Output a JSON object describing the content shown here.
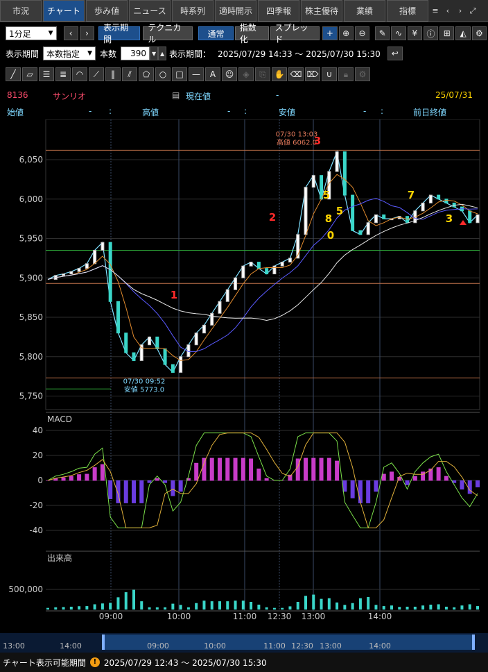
{
  "tabs": [
    {
      "label": "市況",
      "active": false
    },
    {
      "label": "チャート",
      "active": true
    },
    {
      "label": "歩み値",
      "active": false
    },
    {
      "label": "ニュース",
      "active": false
    },
    {
      "label": "時系列",
      "active": false
    },
    {
      "label": "適時開示",
      "active": false
    },
    {
      "label": "四季報",
      "active": false
    },
    {
      "label": "株主優待",
      "active": false
    },
    {
      "label": "業績",
      "active": false
    },
    {
      "label": "指標",
      "active": false
    }
  ],
  "toolbar": {
    "interval": "1分足",
    "display_period": "表示期間",
    "technical": "テクニカル",
    "normal": "通常",
    "index": "指数化",
    "spread": "スプレッド"
  },
  "period": {
    "label": "表示期間",
    "mode": "本数指定",
    "count_label": "本数",
    "count": "390",
    "range_label": "表示期間：",
    "range": "2025/07/29 14:33 ～ 2025/07/30 15:30"
  },
  "quote": {
    "code": "8136",
    "name": "サンリオ",
    "current_label": "現在値",
    "current_value": "-",
    "date": "25/07/31",
    "open_label": "始値",
    "open_value": "-",
    "high_label": "高値",
    "high_value": "-",
    "low_label": "安値",
    "low_value": "-",
    "prev_label": "前日終値",
    "colors": {
      "code": "#ff4d6d",
      "label": "#7fd8ff",
      "date": "#ffd400"
    }
  },
  "chart_data": {
    "type": "candlestick",
    "price_axis": {
      "ticks": [
        "6,050",
        "6,000",
        "5,950",
        "5,900",
        "5,850",
        "5,800",
        "5,750"
      ],
      "values": [
        6050,
        6000,
        5950,
        5900,
        5850,
        5800,
        5750
      ]
    },
    "time_axis": {
      "labels": [
        "09:00",
        "10:00",
        "11:00",
        "12:30",
        "13:00",
        "14:00"
      ]
    },
    "high_annotation": {
      "time": "07/30 13:03",
      "label": "高値 6062.0",
      "value": 6062.0
    },
    "low_annotation": {
      "time": "07/30 09:52",
      "label": "安値 5773.0",
      "value": 5773.0
    },
    "markers": [
      {
        "text": "1",
        "color": "#ff2a2a"
      },
      {
        "text": "2",
        "color": "#ff2a2a"
      },
      {
        "text": "3",
        "color": "#ff2a2a"
      },
      {
        "text": "5",
        "color": "#ffd400"
      },
      {
        "text": "5",
        "color": "#ffd400"
      },
      {
        "text": "8",
        "color": "#ffd400"
      },
      {
        "text": "0",
        "color": "#ffd400"
      },
      {
        "text": "7",
        "color": "#ffd400"
      },
      {
        "text": "3",
        "color": "#ffd400"
      }
    ],
    "price_series": [
      5898,
      5903,
      5905,
      5908,
      5912,
      5918,
      5935,
      5945,
      5870,
      5830,
      5805,
      5795,
      5815,
      5825,
      5810,
      5790,
      5780,
      5800,
      5815,
      5830,
      5840,
      5855,
      5870,
      5885,
      5900,
      5915,
      5920,
      5912,
      5905,
      5915,
      5920,
      5925,
      5955,
      6015,
      6030,
      6000,
      6035,
      6060,
      6005,
      5960,
      5955,
      5970,
      5980,
      5975,
      5975,
      5978,
      5970,
      5985,
      5995,
      6005,
      6000,
      5995,
      5990,
      5985,
      5970,
      5980
    ],
    "macd": {
      "label": "MACD",
      "ticks": [
        "40",
        "20",
        "0",
        "-20",
        "-40"
      ],
      "values": [
        40,
        20,
        0,
        -20,
        -40
      ]
    },
    "volume": {
      "label": "出来高",
      "ticks": [
        "500,000"
      ],
      "values": [
        500000
      ]
    }
  },
  "navigator": {
    "labels": [
      "13:00",
      "14:00",
      "09:00",
      "10:00",
      "11:00",
      "12:30",
      "13:00",
      "14:00"
    ]
  },
  "status": {
    "label": "チャート表示可能期間",
    "range": "2025/07/29 12:43 ～ 2025/07/30 15:30"
  }
}
